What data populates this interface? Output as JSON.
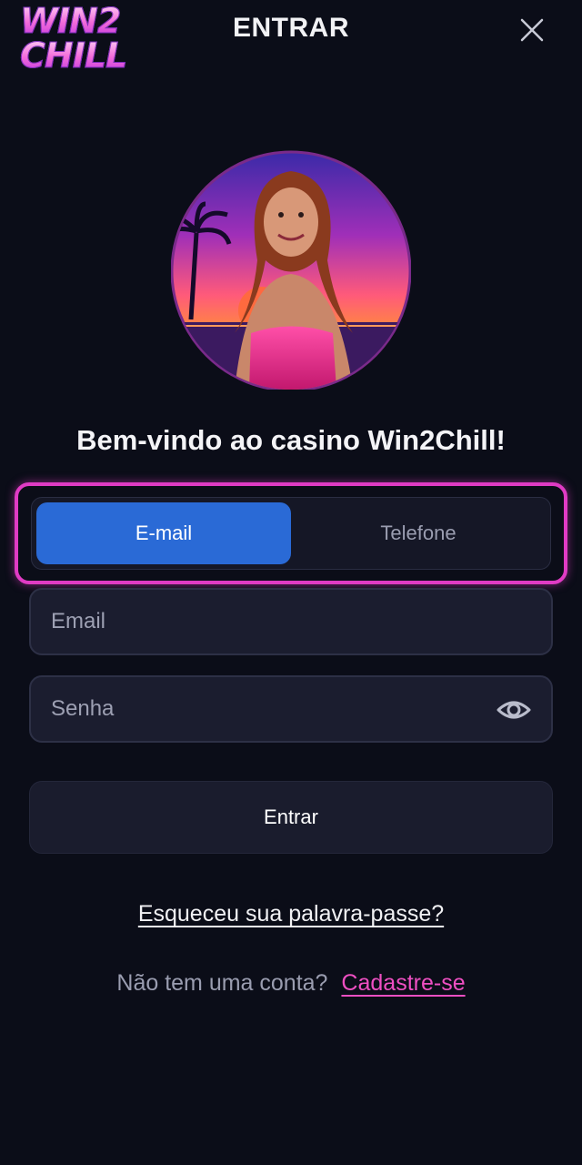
{
  "header": {
    "logo_line1": "WIN2",
    "logo_line2": "CHILL",
    "title": "ENTRAR",
    "close_icon": "close-icon"
  },
  "welcome_text": "Bem-vindo ao casino Win2Chill!",
  "login_tabs": [
    {
      "label": "E-mail",
      "active": true
    },
    {
      "label": "Telefone",
      "active": false
    }
  ],
  "email_field": {
    "placeholder": "Email",
    "value": ""
  },
  "password_field": {
    "placeholder": "Senha",
    "value": "",
    "toggle_icon": "eye-icon"
  },
  "submit_label": "Entrar",
  "forgot_link": "Esqueceu sua palavra-passe?",
  "signup": {
    "prompt": "Não tem uma conta?",
    "link": "Cadastre-se"
  },
  "colors": {
    "background": "#0b0d18",
    "accent_blue": "#2a6ad6",
    "highlight_pink": "#e03bc4",
    "link_pink": "#ee4fc2"
  }
}
